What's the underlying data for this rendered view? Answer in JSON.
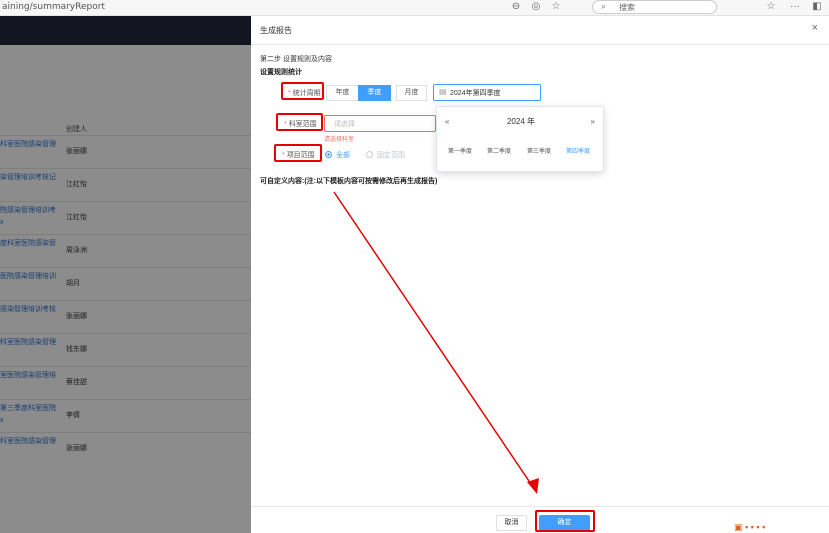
{
  "browser": {
    "url": "aining/summaryReport",
    "search_placeholder": "搜索"
  },
  "background": {
    "column_header": "创建人",
    "rows": [
      {
        "title": "科室医院感染管理",
        "creator": "张丽娜"
      },
      {
        "title": "染管理培训考核记",
        "creator": "江红怡"
      },
      {
        "title": "院感染管理培训考\nx",
        "creator": "江红怡"
      },
      {
        "title": "度科室医院感染管",
        "creator": "周泳洲"
      },
      {
        "title": "医院感染管理培训",
        "creator": "胡月"
      },
      {
        "title": "感染管理培训考核",
        "creator": "张丽娜"
      },
      {
        "title": "科室医院感染管理",
        "creator": "钱东娜"
      },
      {
        "title": "室医院感染管理培",
        "creator": "蔡佳甜"
      },
      {
        "title": "第三季度科室医院\nx",
        "creator": "李倩"
      },
      {
        "title": "科室医院感染管理",
        "creator": "张丽娜"
      }
    ]
  },
  "drawer": {
    "title": "生成报告",
    "close": "×",
    "step": "第二步 设置规则及内容",
    "rules_heading": "设置规则统计",
    "period": {
      "label": "统计周期",
      "options": [
        "年度",
        "季度",
        "月度"
      ],
      "selected": "季度",
      "value": "2024年第四季度"
    },
    "department": {
      "label": "科室范围",
      "placeholder": "请选择",
      "error": "请选择科室"
    },
    "project": {
      "label": "项目范围",
      "options": [
        "全部",
        "固定范围"
      ],
      "selected": "全部"
    },
    "custom_content": "可自定义内容:(注:以下模板内容可按需修改后再生成报告)",
    "picker": {
      "year": "2024 年",
      "prev": "«",
      "next": "»",
      "quarters": [
        "第一季度",
        "第二季度",
        "第三季度",
        "第四季度"
      ],
      "selected_quarter": "第四季度"
    },
    "footer": {
      "cancel": "取消",
      "confirm": "确定"
    }
  },
  "colors": {
    "primary": "#409eff",
    "danger": "#f56c6c",
    "annotation": "#e60000",
    "topbar": "#23283b"
  }
}
